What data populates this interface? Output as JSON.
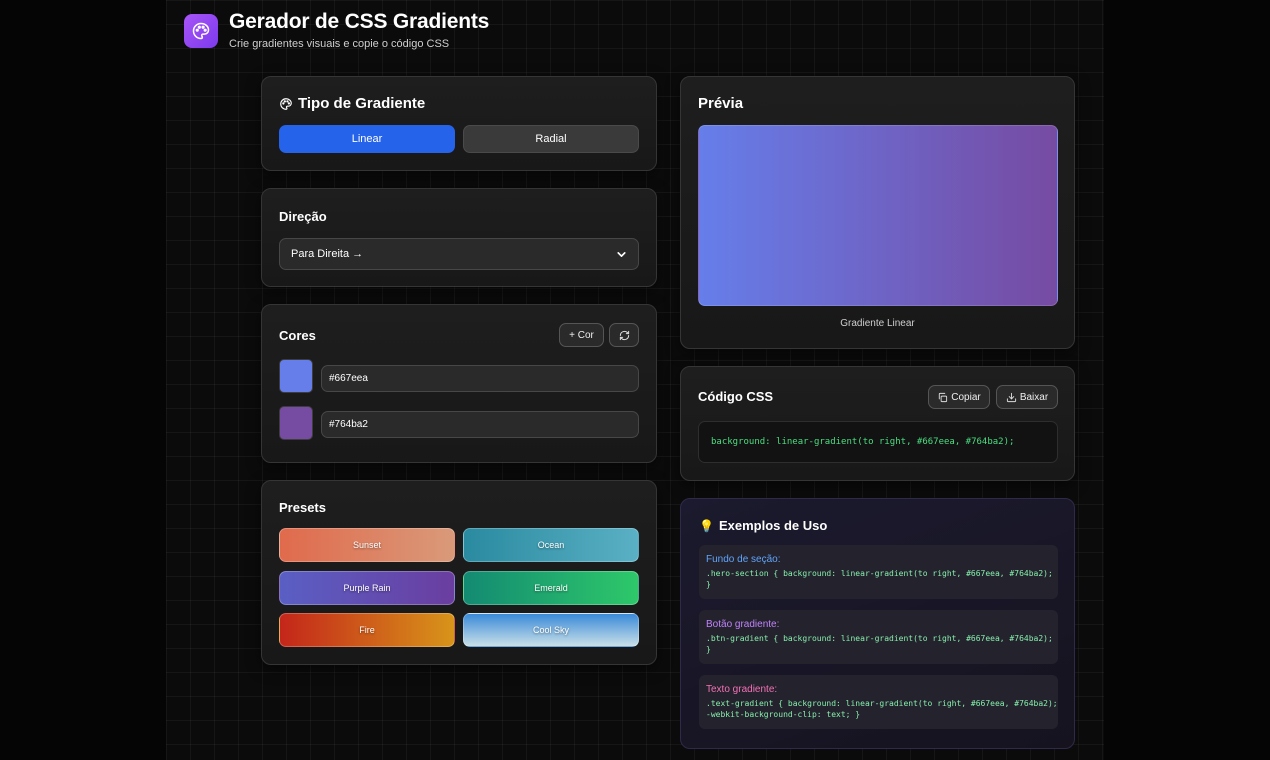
{
  "header": {
    "title": "Gerador de CSS Gradients",
    "subtitle": "Crie gradientes visuais e copie o código CSS"
  },
  "type_card": {
    "title": "Tipo de Gradiente",
    "linear_label": "Linear",
    "radial_label": "Radial",
    "selected": "Linear"
  },
  "direction_card": {
    "title": "Direção",
    "selected": "Para Direita →"
  },
  "colors_card": {
    "title": "Cores",
    "add_label": "+ Cor",
    "colors": [
      "#667eea",
      "#764ba2"
    ]
  },
  "presets_card": {
    "title": "Presets",
    "items": [
      {
        "label": "Sunset",
        "gradient": [
          "#e06a4c",
          "#d99a7a"
        ]
      },
      {
        "label": "Ocean",
        "gradient": [
          "#2a8aa0",
          "#5ab0c4"
        ]
      },
      {
        "label": "Purple Rain",
        "gradient": [
          "#5a5fc4",
          "#6a3ea0"
        ]
      },
      {
        "label": "Emerald",
        "gradient": [
          "#138a72",
          "#2ec86a"
        ]
      },
      {
        "label": "Fire",
        "gradient": [
          "#c4261a",
          "#d8941a"
        ]
      },
      {
        "label": "Cool Sky",
        "gradient": [
          "#3a8ad8",
          "#c8e0e8"
        ]
      }
    ]
  },
  "preview_card": {
    "title": "Prévia",
    "label": "Gradiente Linear",
    "gradient": [
      "#667eea",
      "#764ba2"
    ]
  },
  "code_card": {
    "title": "Código CSS",
    "copy_label": "Copiar",
    "download_label": "Baixar",
    "code": "background: linear-gradient(to right, #667eea, #764ba2);"
  },
  "examples_card": {
    "title": "Exemplos de Uso",
    "items": [
      {
        "label": "Fundo de seção:",
        "color": "#60a5fa",
        "code": ".hero-section { background: linear-gradient(to right, #667eea, #764ba2);\n}"
      },
      {
        "label": "Botão gradiente:",
        "color": "#c084fc",
        "code": ".btn-gradient { background: linear-gradient(to right, #667eea, #764ba2);\n}"
      },
      {
        "label": "Texto gradiente:",
        "color": "#f472b6",
        "code": ".text-gradient { background: linear-gradient(to right, #667eea, #764ba2);\n-webkit-background-clip: text; }"
      }
    ]
  },
  "colors": {
    "accent": "#2563eb",
    "code_green": "#4ade80",
    "logo": "#a855f7"
  }
}
